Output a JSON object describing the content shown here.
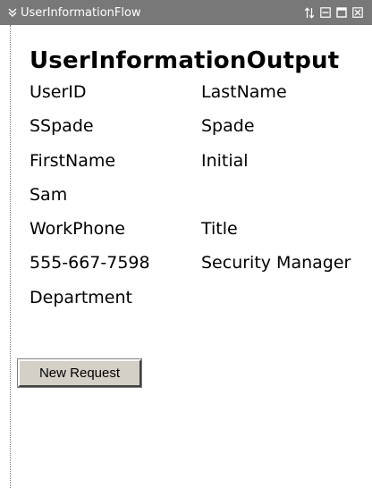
{
  "portlet": {
    "title": "UserInformationFlow",
    "controls": [
      "move-icon",
      "minimize-icon",
      "maximize-icon",
      "close-icon"
    ]
  },
  "output": {
    "heading": "UserInformationOutput",
    "rows": [
      [
        "UserID",
        "LastName"
      ],
      [
        "SSpade",
        "Spade"
      ],
      [
        "FirstName",
        "Initial"
      ],
      [
        "Sam",
        ""
      ],
      [
        "WorkPhone",
        "Title"
      ],
      [
        "555-667-7598",
        "Security Manager"
      ],
      [
        "Department",
        ""
      ]
    ]
  },
  "actions": {
    "new_request_label": "New Request"
  },
  "colors": {
    "titlebar": "#787878",
    "button_face": "#d4d0c8"
  }
}
